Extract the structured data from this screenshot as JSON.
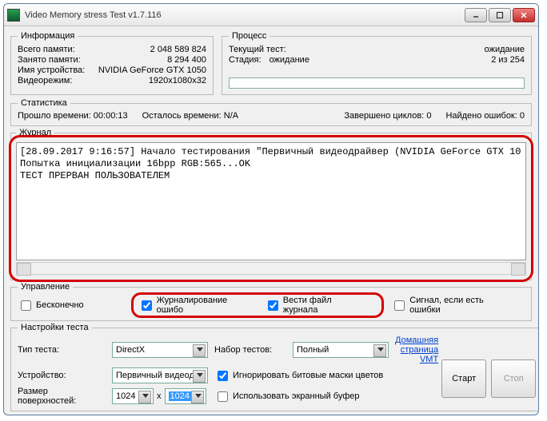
{
  "title": "Video Memory stress Test v1.7.116",
  "info": {
    "legend": "Информация",
    "total_label": "Всего памяти:",
    "total_value": "2 048 589 824",
    "used_label": "Занято памяти:",
    "used_value": "8 294 400",
    "device_label": "Имя устройства:",
    "device_value": "NVIDIA GeForce GTX 1050",
    "mode_label": "Видеорежим:",
    "mode_value": "1920x1080x32"
  },
  "process": {
    "legend": "Процесс",
    "current_label": "Текущий тест:",
    "current_value": "ожидание",
    "stage_label": "Стадия:",
    "stage_value": "ожидание",
    "counter": "2 из 254"
  },
  "stats": {
    "legend": "Статистика",
    "elapsed_label": "Прошло времени:",
    "elapsed_value": "00:00:13",
    "remain_label": "Осталось времени:",
    "remain_value": "N/A",
    "cycles_label": "Завершено циклов:",
    "cycles_value": "0",
    "errors_label": "Найдено ошибок:",
    "errors_value": "0"
  },
  "journal": {
    "legend": "Журнал",
    "text": "[28.09.2017 9:16:57] Начало тестирования \"Первичный видеодрайвер (NVIDIA GeForce GTX 10\nПопытка инициализации 16bpp RGB:565...OK\nТЕСТ ПРЕРВАН ПОЛЬЗОВАТЕЛЕМ"
  },
  "control": {
    "legend": "Управление",
    "infinite": "Бесконечно",
    "log_errors": "Журналирование ошибо",
    "keep_log": "Вести файл журнала",
    "signal": "Сигнал, если есть ошибки"
  },
  "settings": {
    "legend": "Настройки теста",
    "type_label": "Тип теста:",
    "type_value": "DirectX",
    "set_label": "Набор тестов:",
    "set_value": "Полный",
    "device_label": "Устройство:",
    "device_value": "Первичный видеод",
    "ignore": "Игнорировать битовые маски цветов",
    "surf_label": "Размер поверхностей:",
    "surf_w": "1024",
    "surf_x": "x",
    "surf_h": "1024",
    "use_screen": "Использовать экранный буфер",
    "link": "Домашняя страница VMT",
    "start": "Старт",
    "stop": "Стоп"
  }
}
